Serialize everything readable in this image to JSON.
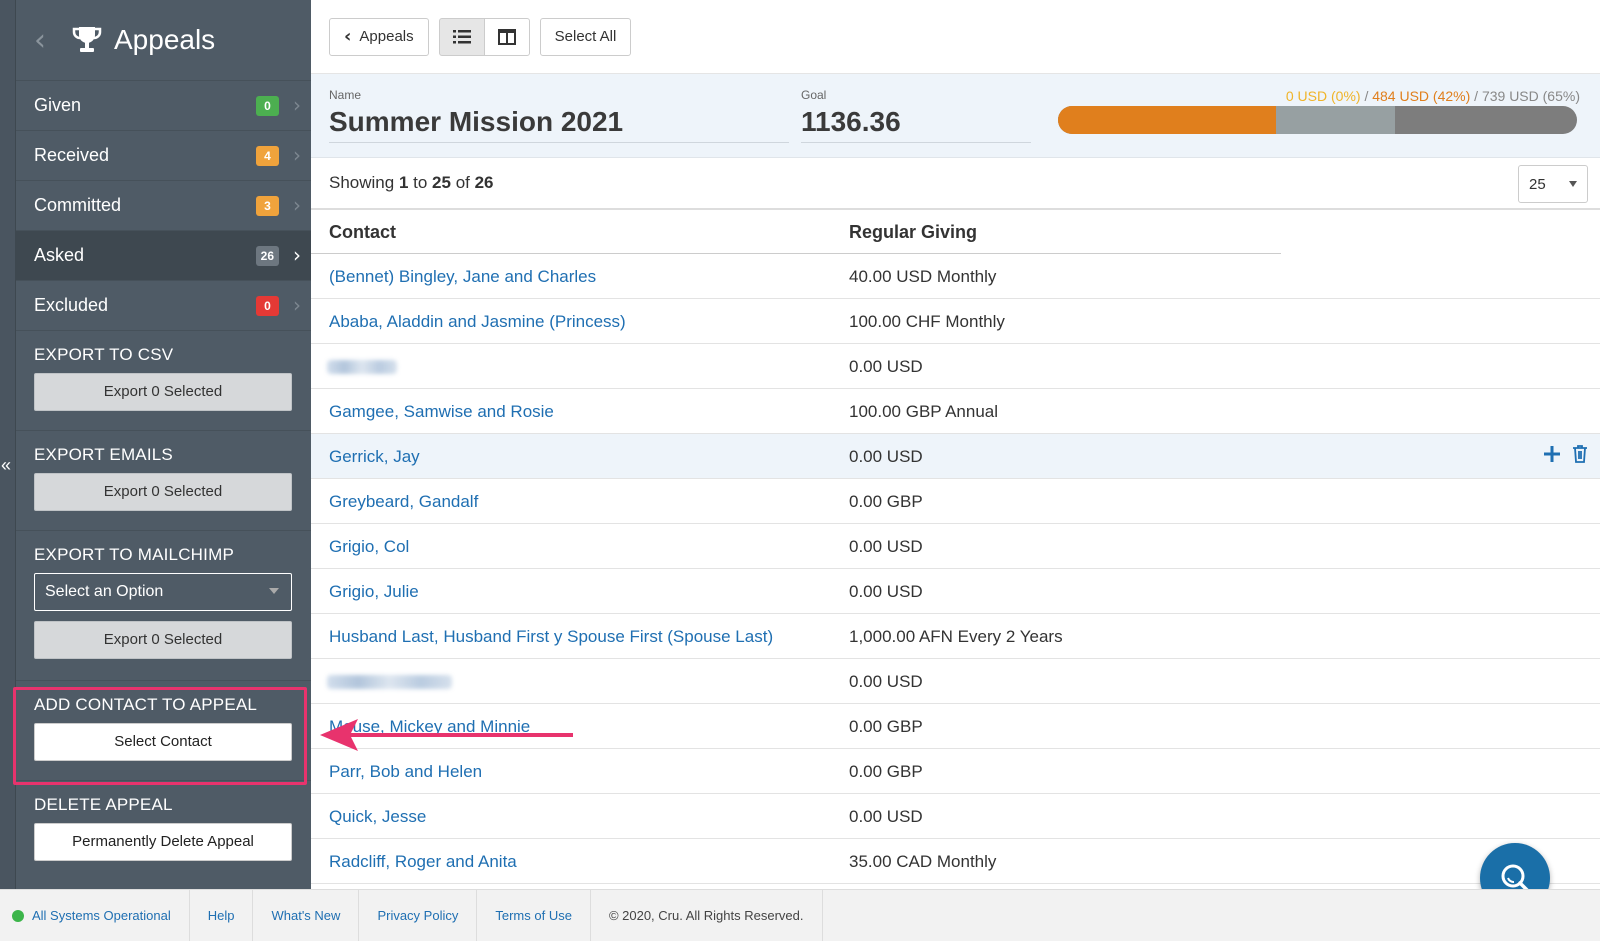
{
  "sidebar": {
    "title": "Appeals",
    "items": [
      {
        "label": "Given",
        "count": "0",
        "color": "#4caf50"
      },
      {
        "label": "Received",
        "count": "4",
        "color": "#f0a33c"
      },
      {
        "label": "Committed",
        "count": "3",
        "color": "#f0a33c"
      },
      {
        "label": "Asked",
        "count": "26",
        "color": "#6d7780"
      },
      {
        "label": "Excluded",
        "count": "0",
        "color": "#e53935"
      }
    ],
    "export_csv": {
      "heading": "EXPORT TO CSV",
      "button": "Export 0 Selected"
    },
    "export_emails": {
      "heading": "EXPORT EMAILS",
      "button": "Export 0 Selected"
    },
    "export_mailchimp": {
      "heading": "EXPORT TO MAILCHIMP",
      "select": "Select an Option",
      "button": "Export 0 Selected"
    },
    "add_contact": {
      "heading": "ADD CONTACT TO APPEAL",
      "button": "Select Contact"
    },
    "delete_appeal": {
      "heading": "DELETE APPEAL",
      "button": "Permanently Delete Appeal"
    }
  },
  "toolbar": {
    "back_label": "Appeals",
    "select_all": "Select All"
  },
  "appeal": {
    "name_label": "Name",
    "name": "Summer Mission 2021",
    "goal_label": "Goal",
    "goal": "1136.36",
    "progress": {
      "given": "0 USD (0%)",
      "received": "484 USD (42%)",
      "committed": "739 USD (65%)",
      "sep": " / ",
      "given_pct": 0,
      "received_pct": 42,
      "committed_pct": 65
    },
    "colors": {
      "given": "#f0b429",
      "received": "#e07f1d",
      "committed": "#97a0a2",
      "track": "#7d7d7d"
    }
  },
  "list": {
    "showing_prefix": "Showing ",
    "from": "1",
    "to_word": " to ",
    "to": "25",
    "of_word": " of ",
    "total": "26",
    "per_page": "25",
    "columns": {
      "contact": "Contact",
      "giving": "Regular Giving"
    },
    "rows": [
      {
        "contact": "(Bennet) Bingley, Jane and Charles",
        "giving": "40.00 USD Monthly"
      },
      {
        "contact": "Ababa, Aladdin and Jasmine (Princess)",
        "giving": "100.00 CHF Monthly"
      },
      {
        "contact": "",
        "giving": "0.00 USD"
      },
      {
        "contact": "Gamgee, Samwise and Rosie",
        "giving": "100.00 GBP Annual"
      },
      {
        "contact": "Gerrick, Jay",
        "giving": "0.00 USD"
      },
      {
        "contact": "Greybeard, Gandalf",
        "giving": "0.00 GBP"
      },
      {
        "contact": "Grigio, Col",
        "giving": "0.00 USD"
      },
      {
        "contact": "Grigio, Julie",
        "giving": "0.00 USD"
      },
      {
        "contact": "Husband Last, Husband First y Spouse First (Spouse Last)",
        "giving": "1,000.00 AFN Every 2 Years"
      },
      {
        "contact": "",
        "giving": "0.00 USD"
      },
      {
        "contact": "Mouse, Mickey and Minnie",
        "giving": "0.00 GBP"
      },
      {
        "contact": "Parr, Bob and Helen",
        "giving": "0.00 GBP"
      },
      {
        "contact": "Quick, Jesse",
        "giving": "0.00 USD"
      },
      {
        "contact": "Radcliff, Roger and Anita",
        "giving": "35.00 CAD Monthly"
      }
    ]
  },
  "footer": {
    "status": "All Systems Operational",
    "help": "Help",
    "whats_new": "What's New",
    "privacy": "Privacy Policy",
    "terms": "Terms of Use",
    "copyright": "© 2020, Cru. All Rights Reserved."
  }
}
